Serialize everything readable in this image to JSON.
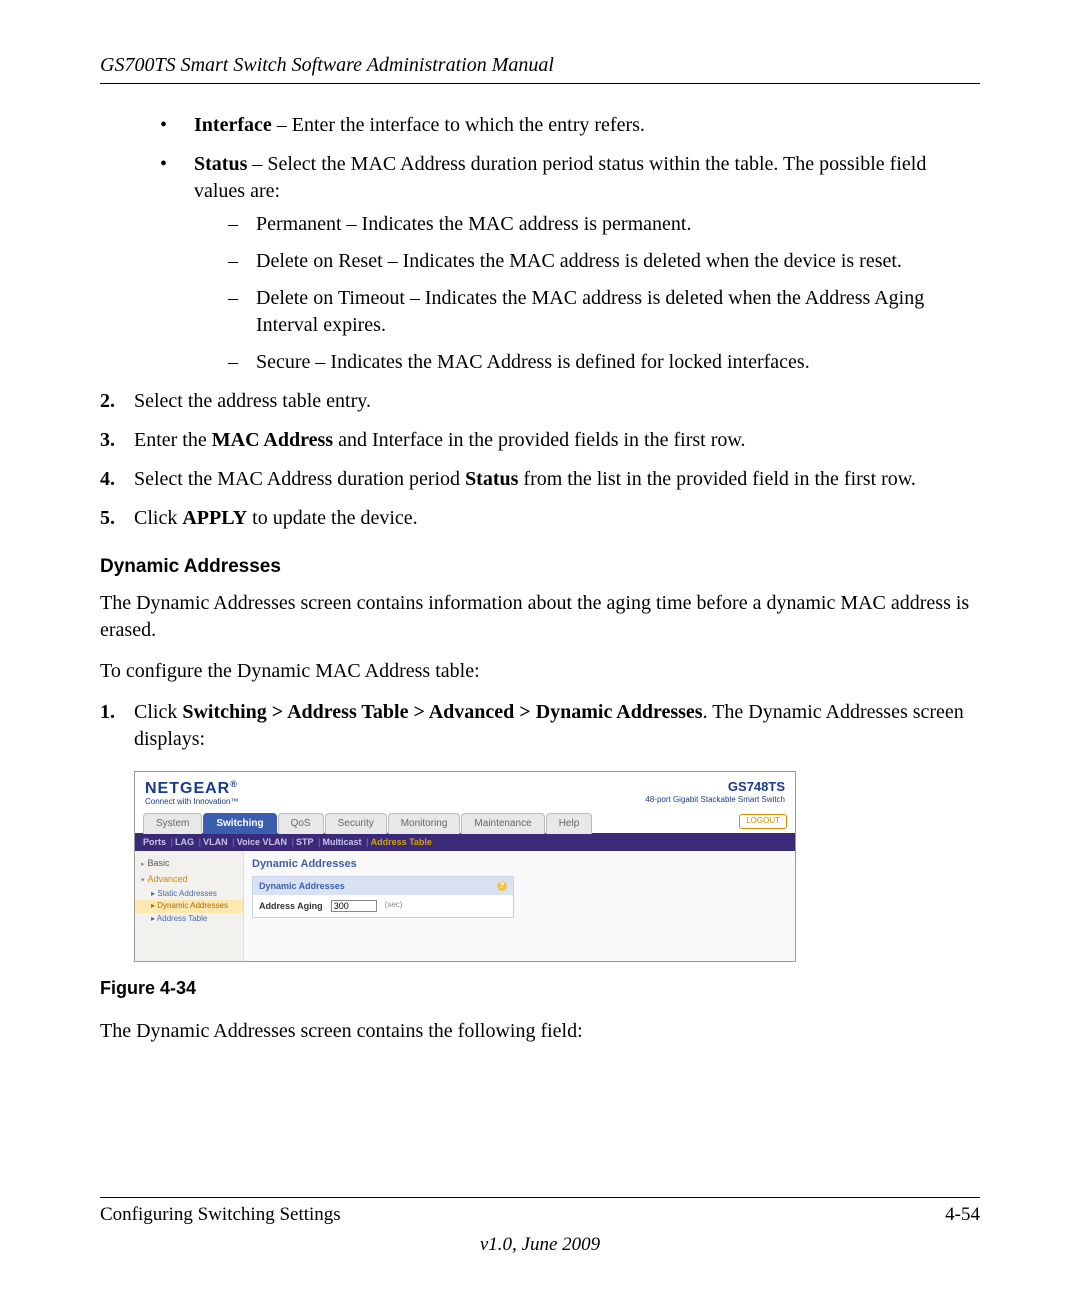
{
  "header": {
    "running_title": "GS700TS Smart Switch Software Administration Manual"
  },
  "bullets": {
    "interface": {
      "term": "Interface",
      "desc": " – Enter the interface to which the entry refers."
    },
    "status": {
      "term": "Status",
      "desc": " – Select the MAC Address duration period status within the table. The possible field values are:",
      "items": {
        "permanent": "Permanent – Indicates the MAC address is permanent.",
        "delete_reset": "Delete on Reset – Indicates the MAC address is deleted when the device is reset.",
        "delete_timeout": "Delete on Timeout – Indicates the MAC address is deleted when the Address Aging Interval expires.",
        "secure": "Secure – Indicates the MAC Address is defined for locked interfaces."
      }
    }
  },
  "steps_a": {
    "s2": {
      "num": "2.",
      "text": "Select the address table entry."
    },
    "s3": {
      "num": "3.",
      "pre": "Enter the ",
      "bold": "MAC Address",
      "post": " and Interface in the provided fields in the first row."
    },
    "s4": {
      "num": "4.",
      "pre": "Select the MAC Address duration period ",
      "bold": "Status",
      "post": " from the list in the provided field in the first row."
    },
    "s5": {
      "num": "5.",
      "pre": "Click ",
      "bold": "APPLY",
      "post": " to update the device."
    }
  },
  "section": {
    "title": "Dynamic Addresses",
    "intro": "The Dynamic Addresses screen contains information about the aging time before a dynamic MAC address is erased.",
    "lead": "To configure the Dynamic MAC Address table:"
  },
  "steps_b": {
    "s1": {
      "num": "1.",
      "pre": "Click ",
      "bold": "Switching > Address Table > Advanced > Dynamic Addresses",
      "post": ". The Dynamic Addresses screen displays:"
    }
  },
  "figure": {
    "logo": "NETGEAR",
    "logo_r": "®",
    "tagline": "Connect with Innovation™",
    "model": "GS748TS",
    "model_desc": "48-port Gigabit Stackable Smart Switch",
    "logout": "LOGOUT",
    "main_tabs": {
      "system": "System",
      "switching": "Switching",
      "qos": "QoS",
      "security": "Security",
      "monitoring": "Monitoring",
      "maintenance": "Maintenance",
      "help": "Help"
    },
    "sub_tabs": {
      "ports": "Ports",
      "lag": "LAG",
      "vlan": "VLAN",
      "voice_vlan": "Voice VLAN",
      "stp": "STP",
      "multicast": "Multicast",
      "address_table": "Address Table"
    },
    "sidebar": {
      "basic": "Basic",
      "advanced": "Advanced",
      "static": "Static Addresses",
      "dynamic": "Dynamic Addresses",
      "addr_table": "Address Table"
    },
    "content": {
      "title": "Dynamic Addresses",
      "panel_title": "Dynamic Addresses",
      "field_label": "Address Aging",
      "field_value": "300",
      "unit": "(sec)"
    },
    "caption": "Figure 4-34"
  },
  "after_figure": "The Dynamic Addresses screen contains the following field:",
  "footer": {
    "left": "Configuring Switching Settings",
    "right": "4-54",
    "version": "v1.0, June 2009"
  }
}
